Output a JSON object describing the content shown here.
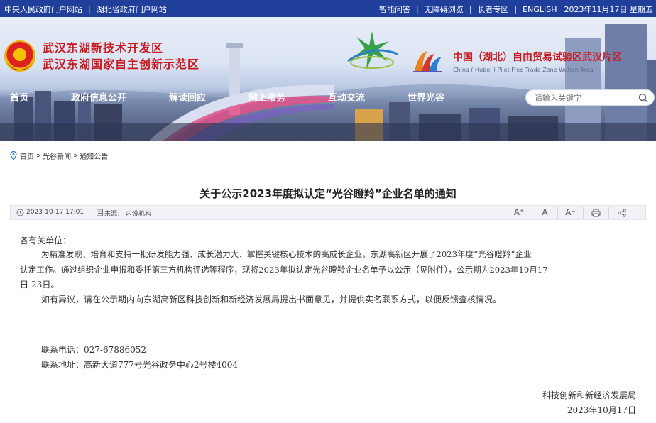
{
  "topbar": {
    "links_left": [
      "中央人民政府门户网站",
      "湖北省政府门户网站"
    ],
    "links_right": [
      "智能问答",
      "无障碍浏览",
      "长者专区",
      "ENGLISH"
    ],
    "date": "2023年11月17日 星期五"
  },
  "header": {
    "org_line1": "武汉东湖新技术开发区",
    "org_line2": "武汉东湖国家自主创新示范区",
    "ftz_cn": "中国（湖北）自由贸易试验区武汉片区",
    "ftz_en": "China ( Hubei ) Pilot Free Trade Zone Wuhan Area"
  },
  "nav": {
    "items": [
      "首页",
      "政府信息公开",
      "解读回应",
      "网上服务",
      "互动交流",
      "世界光谷"
    ]
  },
  "search": {
    "placeholder": "请输入关键字"
  },
  "breadcrumb": [
    "首页",
    "»",
    "光谷新闻",
    "»",
    "通知公告"
  ],
  "article": {
    "title": "关于公示2023年度拟认定“光谷瞪羚”企业名单的通知",
    "date": "2023-10-17 17:01",
    "source": "来源：  内设机构",
    "tools": [
      "A⁺",
      "A",
      "A⁻"
    ],
    "salutation": "各有关单位：",
    "para1_line1": "为精准发现、培育和支持一批研发能力强、成长潜力大、掌握关键核心技术的高成长企业，东湖高新区开展了2023年度“光谷瞪羚”企业",
    "para1_line2": "认定工作。通过组织企业申报和委托第三方机构评选等程序，现将2023年拟认定光谷瞪羚企业名单予以公示（见附件），公示期为2023年10月17",
    "para1_line3": "日-23日。",
    "para2": "如有异议，请在公示期内向东湖高新区科技创新和新经济发展局提出书面意见，并提供实名联系方式，以便反馈查核情况。",
    "phone": "联系电话：027-67886052",
    "address": "联系地址：高新大道777号光谷政务中心2号楼4004",
    "signer": "科技创新和新经济发展局",
    "sign_date": "2023年10月17日"
  }
}
